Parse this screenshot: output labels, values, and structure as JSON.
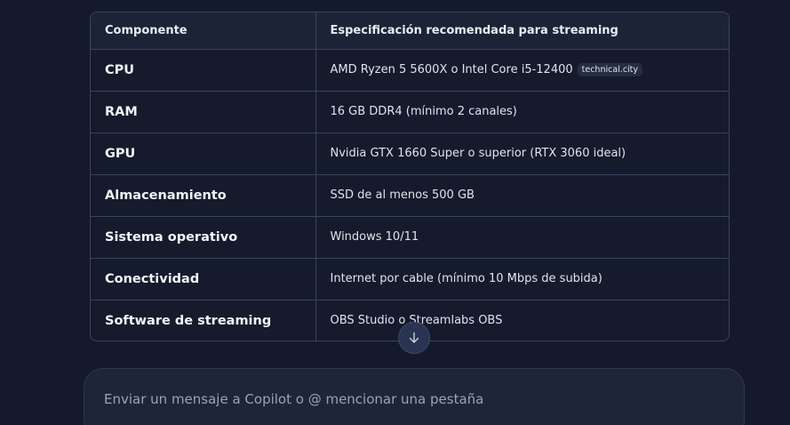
{
  "table": {
    "headers": [
      "Componente",
      "Especificación recomendada para streaming"
    ],
    "rows": [
      {
        "component": "CPU",
        "spec": "AMD Ryzen 5 5600X o Intel Core i5-12400",
        "citation": "technical.city"
      },
      {
        "component": "RAM",
        "spec": "16 GB DDR4 (mínimo 2 canales)"
      },
      {
        "component": "GPU",
        "spec": "Nvidia GTX 1660 Super o superior (RTX 3060 ideal)"
      },
      {
        "component": "Almacenamiento",
        "spec": "SSD de al menos 500 GB"
      },
      {
        "component": "Sistema operativo",
        "spec": "Windows 10/11"
      },
      {
        "component": "Conectividad",
        "spec": "Internet por cable (mínimo 10 Mbps de subida)"
      },
      {
        "component": "Software de streaming",
        "spec": "OBS Studio o Streamlabs OBS"
      }
    ]
  },
  "scroll_button": {
    "icon": "arrow-down-icon"
  },
  "composer": {
    "placeholder": "Enviar un mensaje a Copilot o @ mencionar una pestaña",
    "value": ""
  },
  "colors": {
    "background": "#141a2b",
    "table_border": "#3a4360",
    "header_bg": "#1c2336",
    "composer_bg": "#1e2536",
    "scroll_button_bg": "#2a3452"
  }
}
